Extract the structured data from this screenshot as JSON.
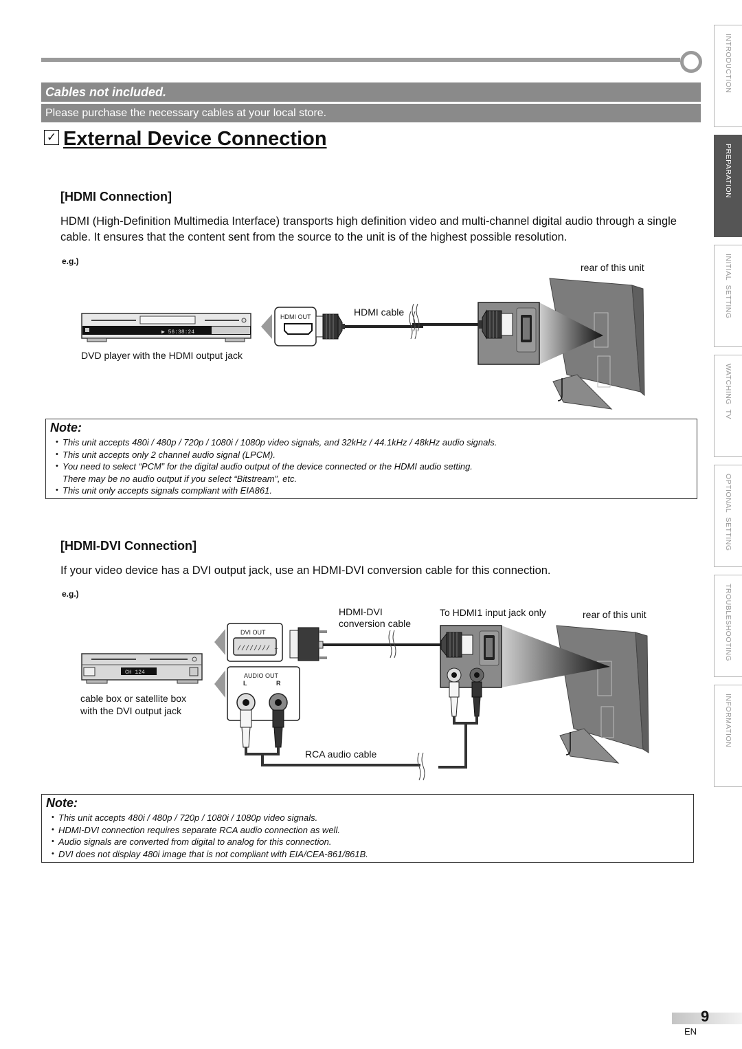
{
  "banner": {
    "cables_not_included": "Cables not included.",
    "purchase_note": "Please purchase the necessary cables at your local store."
  },
  "title": {
    "checkbox_glyph": "✓",
    "text": "External Device Connection"
  },
  "side_tabs": [
    {
      "label": "INTRODUCTION",
      "active": false
    },
    {
      "label": "PREPARATION",
      "active": true
    },
    {
      "label": "INITIAL  SETTING",
      "active": false
    },
    {
      "label": "WATCHING  TV",
      "active": false
    },
    {
      "label": "OPTIONAL  SETTING",
      "active": false
    },
    {
      "label": "TROUBLESHOOTING",
      "active": false
    },
    {
      "label": "INFORMATION",
      "active": false
    }
  ],
  "hdmi": {
    "heading": "[HDMI Connection]",
    "body": "HDMI (High-Definition Multimedia Interface) transports high definition video and multi-channel digital audio through a single cable. It ensures that the content sent from the source to the unit is of the highest possible resolution.",
    "eg": "e.g.)",
    "diagram": {
      "rear_label": "rear of this unit",
      "cable_label": "HDMI cable",
      "jack_label": "HDMI OUT",
      "device_caption": "DVD player with the HDMI output jack",
      "device_display": "▶ 56:38:24"
    },
    "note": {
      "title": "Note:",
      "items": [
        [
          "This unit accepts 480i / 480p / 720p / 1080i / 1080p video signals, and 32kHz / 44.1kHz / 48kHz audio signals."
        ],
        [
          "This unit accepts only 2 channel audio signal (LPCM)."
        ],
        [
          "You need to select “PCM” for the digital audio output of the device connected or the HDMI audio setting.",
          "There may be no audio output if you select “Bitstream”, etc."
        ],
        [
          "This unit only accepts signals compliant with EIA861."
        ]
      ]
    }
  },
  "hdmi_dvi": {
    "heading": "[HDMI-DVI Connection]",
    "body": "If your video device has a DVI output jack, use an HDMI-DVI conversion cable for this connection.",
    "eg": "e.g.)",
    "diagram": {
      "conversion_cable_label_1": "HDMI-DVI",
      "conversion_cable_label_2": "conversion cable",
      "hdmi1_label": "To HDMI1 input jack only",
      "rear_label": "rear of this unit",
      "dvi_out_label": "DVI OUT",
      "audio_out_label": "AUDIO OUT",
      "audio_l": "L",
      "audio_r": "R",
      "rca_label": "RCA audio cable",
      "device_caption_1": "cable box or satellite box",
      "device_caption_2": "with the DVI output jack",
      "device_display": "CH 124"
    },
    "note": {
      "title": "Note:",
      "items": [
        [
          "This unit accepts 480i / 480p / 720p / 1080i / 1080p video signals."
        ],
        [
          "HDMI-DVI connection requires separate RCA audio connection as well."
        ],
        [
          "Audio signals are converted from digital to analog for this connection."
        ],
        [
          "DVI does not display 480i image that is not compliant with EIA/CEA-861/861B."
        ]
      ]
    }
  },
  "footer": {
    "page_number": "9",
    "language": "EN"
  }
}
